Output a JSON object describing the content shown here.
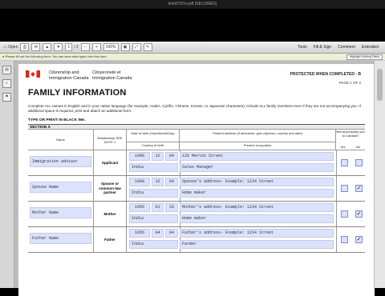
{
  "window": {
    "title": "imm5707e.pdf (SECURED)"
  },
  "toolbar": {
    "open_label": "Open",
    "page_current": "1",
    "page_total": "/ 2",
    "zoom": "142%",
    "tools_label": "Tools",
    "fill_sign_label": "Fill & Sign",
    "comment_label": "Comment",
    "extended_label": "Extended"
  },
  "infobar": {
    "message": "Please fill out the following form. You can save data typed into this form.",
    "highlight_button": "Highlight Existing Fields"
  },
  "form": {
    "agency_en_line1": "Citizenship and",
    "agency_en_line2": "Immigration Canada",
    "agency_fr_line1": "Citoyenneté et",
    "agency_fr_line2": "Immigration Canada",
    "protected": "PROTECTED WHEN COMPLETED - B",
    "page_indicator": "PAGE 1 OF 2",
    "title": "FAMILY INFORMATION",
    "intro": "Complete ALL names in English and in your native language (for example, Arabic, Cyrillic, Chinese, Korean, or Japanese characters). Include ALL family members even if they are not accompanying you. If additional space is required, print and attach an additional form.",
    "type_note": "TYPE OR PRINT IN BLACK INK.",
    "section": "SECTION A"
  },
  "headers": {
    "name": "Name",
    "relationship": "Relationship SEE NOTE 1",
    "dob": "Date of birth (Year/Month/Day)",
    "country": "Country of birth",
    "address": "Present address (If deceased, give city/town, country and date)",
    "occupation": "Present occupation",
    "accompany": "Will accompany you to Canada?",
    "yes": "Yes",
    "no": "No"
  },
  "rows": [
    {
      "name": "Immigration advisor",
      "relationship": "Applicant",
      "dob_year": "1990",
      "dob_month": "12",
      "dob_day": "04",
      "country": "India",
      "address": "120 Merton Street",
      "occupation": "Sales Manager",
      "accompany": ""
    },
    {
      "name": "Spouse Name",
      "relationship": "Spouse or common-law partner",
      "dob_year": "1990",
      "dob_month": "12",
      "dob_day": "04",
      "country": "India",
      "address": "Spouse's address- Example: 1234 Street",
      "occupation": "Home maker",
      "accompany": "no"
    },
    {
      "name": "Mother Name",
      "relationship": "Mother",
      "dob_year": "1956",
      "dob_month": "01",
      "dob_day": "28",
      "country": "India",
      "address": "Mother's address- Example: 1234 Street",
      "occupation": "Home maker",
      "accompany": "no"
    },
    {
      "name": "Father Name",
      "relationship": "Father",
      "dob_year": "1955",
      "dob_month": "04",
      "dob_day": "04",
      "country": "India",
      "address": "Father's address- Example: 1234 Street",
      "occupation": "Farmer",
      "accompany": "no"
    }
  ],
  "colors": {
    "field_fill": "#dbe2fb",
    "page_bg": "#ffffff",
    "flag_red": "#d52b1e"
  },
  "check_glyph": "✓"
}
